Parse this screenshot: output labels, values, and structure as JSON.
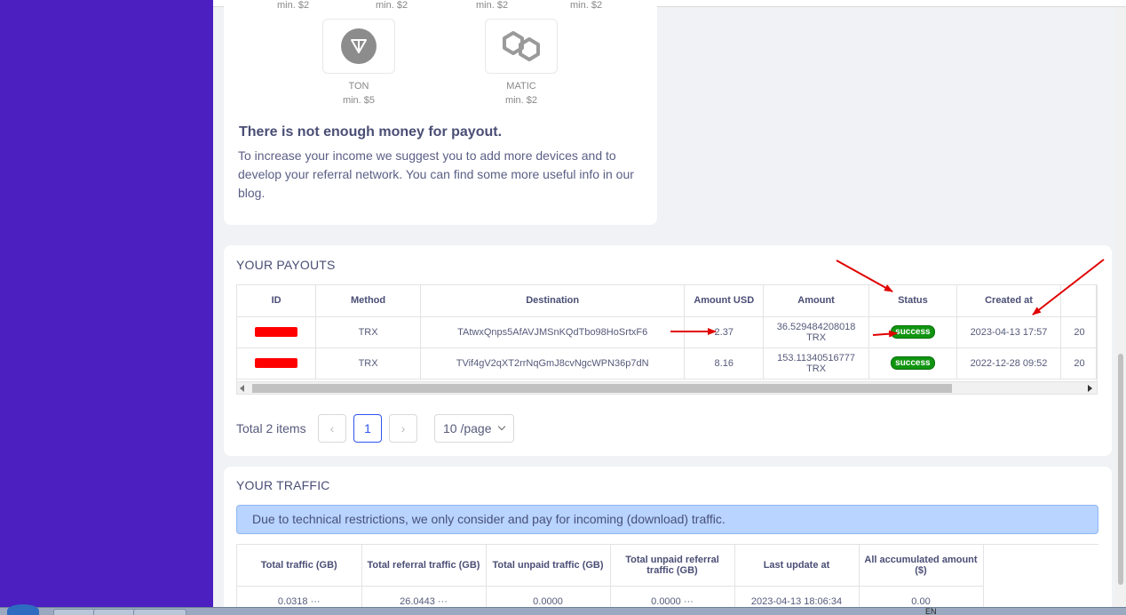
{
  "methods": {
    "partial_mins": [
      "min. $2",
      "min. $2",
      "min. $2",
      "min. $2"
    ],
    "items": [
      {
        "name": "TON",
        "min": "min. $5"
      },
      {
        "name": "MATIC",
        "min": "min. $2"
      }
    ],
    "message_title": "There is not enough money for payout.",
    "message_text": "To increase your income we suggest you to add more devices and to develop your referral network. You can find some more useful info in our",
    "message_link": "blog",
    "message_end": "."
  },
  "payouts": {
    "title": "YOUR PAYOUTS",
    "columns": [
      "ID",
      "Method",
      "Destination",
      "Amount USD",
      "Amount",
      "Status",
      "Created at",
      ""
    ],
    "rows": [
      {
        "method": "TRX",
        "destination": "TAtwxQnps5AfAVJMSnKQdTbo98HoSrtxF6",
        "amount_usd": "2.37",
        "amount": "36.529484208018",
        "amount_unit": "TRX",
        "status": "success",
        "created_at": "2023-04-13 17:57",
        "extra": "20"
      },
      {
        "method": "TRX",
        "destination": "TVif4gV2qXT2rrNqGmJ8cvNgcWPN36p7dN",
        "amount_usd": "8.16",
        "amount": "153.11340516777",
        "amount_unit": "TRX",
        "status": "success",
        "created_at": "2022-12-28 09:52",
        "extra": "20"
      }
    ],
    "total": "Total 2 items",
    "current_page": "1",
    "page_size": "10 /page",
    "prev_symbol": "‹",
    "next_symbol": "›"
  },
  "traffic": {
    "title": "YOUR TRAFFIC",
    "notice": "Due to technical restrictions, we only consider and pay for incoming (download) traffic.",
    "columns": [
      "Total traffic (GB)",
      "Total referral traffic (GB)",
      "Total unpaid traffic (GB)",
      "Total unpaid referral traffic (GB)",
      "Last update at",
      "All accumulated amount ($)"
    ],
    "row": {
      "total": "0.0318",
      "referral": "26.0443",
      "unpaid": "0.0000",
      "unpaid_referral": "0.0000",
      "last_update": "2023-04-13 18:06:34",
      "accumulated": "0.00"
    },
    "ellipsis": "···"
  },
  "taskbar": {
    "lang": "EN"
  },
  "colors": {
    "sidebar": "#4b1fc0",
    "success": "#119511",
    "annotation": "#e00000",
    "notice_bg": "#b8d4ff"
  },
  "icons": [
    "ton-icon",
    "matic-icon",
    "chevron-left-icon",
    "chevron-right-icon",
    "chevron-down-icon"
  ]
}
